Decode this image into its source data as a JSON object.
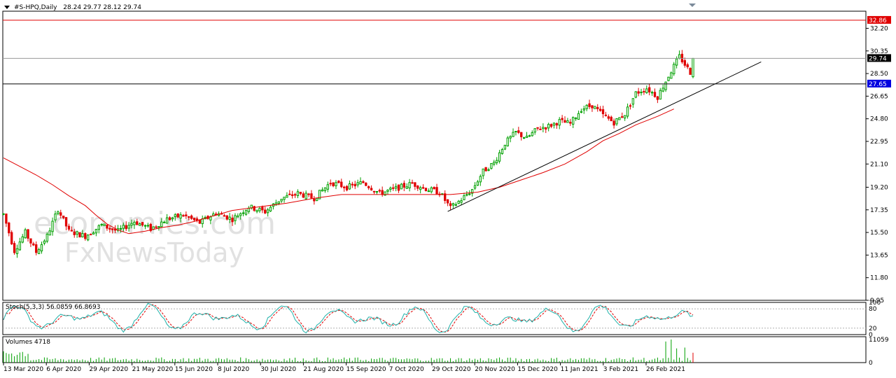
{
  "header": {
    "symbol_label": "#S-HPQ,Daily",
    "ohlc_label": "28.24 29.77 28.12 29.74"
  },
  "indicators": {
    "stoch_label": "Stoch(5,3,3) 56.0859 66.8693",
    "volume_label": "Volumes 4718"
  },
  "price_lines": {
    "upper": {
      "value": "32.86",
      "color": "#e00000"
    },
    "current": {
      "value": "29.74",
      "color": "#000000"
    },
    "lower": {
      "value": "27.65",
      "color": "#0000e0"
    }
  },
  "watermark": {
    "line1": "economies.com",
    "line2": "FxNewsToday"
  },
  "colors": {
    "bull": "#00a000",
    "bear": "#e00000",
    "ma": "#e00000",
    "stoch_main": "#20b2aa",
    "stoch_signal": "#e00000",
    "volume": "#00a000",
    "trendline": "#000000"
  },
  "chart_data": {
    "type": "candlestick",
    "y_axis_ticks": [
      "32.20",
      "30.35",
      "28.50",
      "26.65",
      "24.80",
      "22.95",
      "21.10",
      "19.20",
      "17.35",
      "15.50",
      "13.65",
      "11.80",
      "9.95"
    ],
    "x_axis_ticks": [
      "13 Mar 2020",
      "6 Apr 2020",
      "29 Apr 2020",
      "21 May 2020",
      "15 Jun 2020",
      "8 Jul 2020",
      "30 Jul 2020",
      "21 Aug 2020",
      "15 Sep 2020",
      "7 Oct 2020",
      "29 Oct 2020",
      "20 Nov 2020",
      "15 Dec 2020",
      "11 Jan 2021",
      "3 Feb 2021",
      "26 Feb 2021"
    ],
    "ylim": [
      9.95,
      33.6
    ],
    "stoch_levels": [
      "100",
      "80",
      "20",
      "0"
    ],
    "volume_ticks": [
      "11059",
      "0"
    ],
    "price_path": [
      [
        0,
        17.0
      ],
      [
        4,
        14.0
      ],
      [
        8,
        15.5
      ],
      [
        12,
        13.9
      ],
      [
        16,
        15.2
      ],
      [
        20,
        17.4
      ],
      [
        24,
        15.6
      ],
      [
        30,
        15.2
      ],
      [
        36,
        16.1
      ],
      [
        42,
        15.6
      ],
      [
        48,
        16.4
      ],
      [
        54,
        15.8
      ],
      [
        60,
        16.6
      ],
      [
        66,
        16.9
      ],
      [
        72,
        16.3
      ],
      [
        78,
        17.1
      ],
      [
        84,
        16.6
      ],
      [
        90,
        17.6
      ],
      [
        96,
        17.2
      ],
      [
        102,
        18.3
      ],
      [
        108,
        18.7
      ],
      [
        114,
        18.3
      ],
      [
        120,
        19.6
      ],
      [
        126,
        19.2
      ],
      [
        132,
        19.6
      ],
      [
        138,
        18.7
      ],
      [
        144,
        19.1
      ],
      [
        150,
        19.5
      ],
      [
        156,
        19.0
      ],
      [
        160,
        18.8
      ],
      [
        164,
        17.5
      ],
      [
        168,
        18.2
      ],
      [
        172,
        19.0
      ],
      [
        176,
        20.5
      ],
      [
        180,
        21.2
      ],
      [
        184,
        22.8
      ],
      [
        188,
        23.7
      ],
      [
        192,
        23.2
      ],
      [
        196,
        24.0
      ],
      [
        200,
        24.2
      ],
      [
        204,
        24.6
      ],
      [
        208,
        24.4
      ],
      [
        212,
        25.6
      ],
      [
        216,
        25.9
      ],
      [
        220,
        25.1
      ],
      [
        224,
        24.5
      ],
      [
        228,
        25.2
      ],
      [
        232,
        26.9
      ],
      [
        236,
        27.3
      ],
      [
        240,
        26.6
      ],
      [
        244,
        28.3
      ],
      [
        248,
        29.9
      ],
      [
        252,
        28.6
      ],
      [
        253,
        29.74
      ]
    ],
    "ma_path": [
      [
        0,
        21.6
      ],
      [
        6,
        20.9
      ],
      [
        12,
        20.2
      ],
      [
        18,
        19.4
      ],
      [
        24,
        18.5
      ],
      [
        30,
        17.7
      ],
      [
        34,
        16.9
      ],
      [
        38,
        16.2
      ],
      [
        42,
        15.7
      ],
      [
        46,
        15.4
      ],
      [
        52,
        15.6
      ],
      [
        58,
        15.9
      ],
      [
        64,
        16.1
      ],
      [
        70,
        16.4
      ],
      [
        76,
        16.8
      ],
      [
        84,
        17.3
      ],
      [
        94,
        17.6
      ],
      [
        104,
        17.9
      ],
      [
        114,
        18.3
      ],
      [
        124,
        18.6
      ],
      [
        134,
        18.6
      ],
      [
        144,
        18.6
      ],
      [
        154,
        18.6
      ],
      [
        164,
        18.6
      ],
      [
        174,
        18.8
      ],
      [
        182,
        19.2
      ],
      [
        190,
        19.8
      ],
      [
        198,
        20.4
      ],
      [
        206,
        21.1
      ],
      [
        214,
        22.1
      ],
      [
        220,
        23.0
      ],
      [
        226,
        23.6
      ],
      [
        232,
        24.3
      ],
      [
        240,
        25.0
      ],
      [
        246,
        25.6
      ]
    ],
    "trendline": [
      [
        163,
        17.22
      ],
      [
        278,
        29.45
      ]
    ],
    "volume_spikes": [
      [
        243,
        10100
      ],
      [
        245,
        11059
      ],
      [
        247,
        6800
      ],
      [
        250,
        7200
      ],
      [
        253,
        4718
      ]
    ]
  }
}
